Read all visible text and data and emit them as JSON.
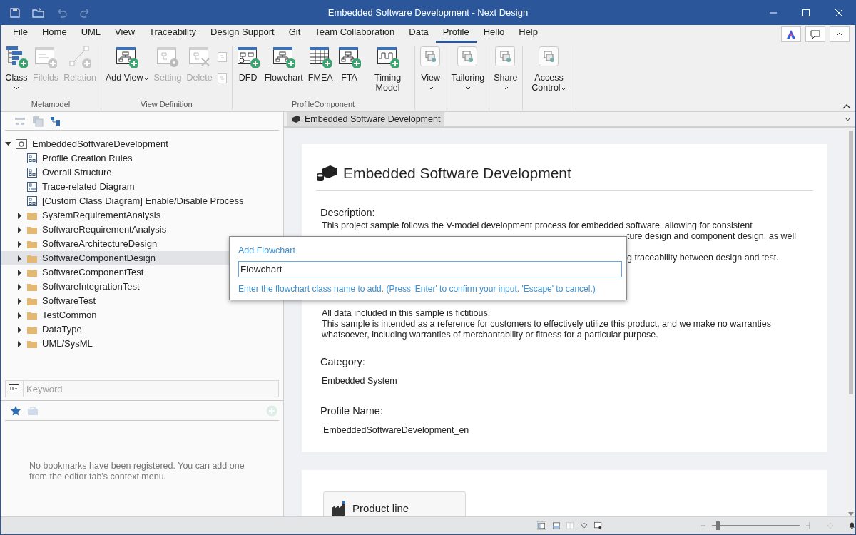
{
  "window": {
    "title": "Embedded Software Development - Next Design"
  },
  "menu": [
    {
      "label": "File",
      "selected": false
    },
    {
      "label": "Home",
      "selected": false
    },
    {
      "label": "UML",
      "selected": false
    },
    {
      "label": "View",
      "selected": false
    },
    {
      "label": "Traceability",
      "selected": false
    },
    {
      "label": "Design Support",
      "selected": false
    },
    {
      "label": "Git",
      "selected": false
    },
    {
      "label": "Team Collaboration",
      "selected": false
    },
    {
      "label": "Data",
      "selected": false
    },
    {
      "label": "Profile",
      "selected": true
    },
    {
      "label": "Hello",
      "selected": false
    },
    {
      "label": "Help",
      "selected": false
    }
  ],
  "ribbon_groups": [
    {
      "label": "Metamodel",
      "buttons": [
        {
          "label": "Class",
          "kind": "class",
          "disabled": false,
          "dropdown": true
        },
        {
          "label": "Filelds",
          "kind": "fields",
          "disabled": true,
          "dropdown": false
        },
        {
          "label": "Relation",
          "kind": "relation",
          "disabled": true,
          "dropdown": false
        }
      ]
    },
    {
      "label": "View Definition",
      "buttons": [
        {
          "label": "Add View",
          "kind": "diagram",
          "disabled": false,
          "dropdown": true
        },
        {
          "label": "Setting",
          "kind": "setting",
          "disabled": true,
          "dropdown": false
        },
        {
          "label": "Delete",
          "kind": "delete",
          "disabled": true,
          "dropdown": false
        },
        {
          "kind": "small-pair",
          "disabled": true
        }
      ]
    },
    {
      "label": "ProfileComponent",
      "buttons": [
        {
          "label": "DFD",
          "kind": "dfd",
          "disabled": false,
          "dropdown": false
        },
        {
          "label": "Flowchart",
          "kind": "diagram",
          "disabled": false,
          "dropdown": false
        },
        {
          "label": "FMEA",
          "kind": "table",
          "disabled": false,
          "dropdown": false
        },
        {
          "label": "FTA",
          "kind": "diagram",
          "disabled": false,
          "dropdown": false
        },
        {
          "label": "Timing Model",
          "kind": "timing",
          "disabled": false,
          "dropdown": false
        }
      ]
    },
    {
      "buttons": [
        {
          "label": "View",
          "kind": "tile",
          "disabled": false,
          "dropdown": true
        }
      ]
    },
    {
      "buttons": [
        {
          "label": "Tailoring",
          "kind": "tile",
          "disabled": false,
          "dropdown": true
        }
      ]
    },
    {
      "buttons": [
        {
          "label": "Share",
          "kind": "tile",
          "disabled": false,
          "dropdown": true
        }
      ]
    },
    {
      "buttons": [
        {
          "label": "Access Control",
          "kind": "tile",
          "disabled": false,
          "dropdown": true
        }
      ]
    }
  ],
  "tree": [
    {
      "label": "EmbeddedSoftwareDevelopment",
      "kind": "project",
      "expanded": true,
      "selected": false,
      "children": [
        {
          "label": "Profile Creation Rules",
          "kind": "diagram",
          "selected": false
        },
        {
          "label": "Overall Structure",
          "kind": "diagram",
          "selected": false
        },
        {
          "label": "Trace-related Diagram",
          "kind": "diagram",
          "selected": false
        },
        {
          "label": "[Custom Class Diagram] Enable/Disable Process",
          "kind": "diagram",
          "selected": false
        },
        {
          "label": "SystemRequirementAnalysis",
          "kind": "folder",
          "expanded": false,
          "selected": false
        },
        {
          "label": "SoftwareRequirementAnalysis",
          "kind": "folder",
          "expanded": false,
          "selected": false
        },
        {
          "label": "SoftwareArchitectureDesign",
          "kind": "folder",
          "expanded": false,
          "selected": false
        },
        {
          "label": "SoftwareComponentDesign",
          "kind": "folder",
          "expanded": false,
          "selected": true
        },
        {
          "label": "SoftwareComponentTest",
          "kind": "folder",
          "expanded": false,
          "selected": false
        },
        {
          "label": "SoftwareIntegrationTest",
          "kind": "folder",
          "expanded": false,
          "selected": false
        },
        {
          "label": "SoftwareTest",
          "kind": "folder",
          "expanded": false,
          "selected": false
        },
        {
          "label": "TestCommon",
          "kind": "folder",
          "expanded": false,
          "selected": false
        },
        {
          "label": "DataType",
          "kind": "folder",
          "expanded": false,
          "selected": false
        },
        {
          "label": "UML/SysML",
          "kind": "folder",
          "expanded": false,
          "selected": false
        }
      ]
    }
  ],
  "search": {
    "placeholder": "Keyword"
  },
  "bookmarks": {
    "message": "No bookmarks have been registered. You can add one from the editor tab's context menu."
  },
  "editor_tab": {
    "label": "Embedded Software Development"
  },
  "overview": {
    "title": "Embedded Software Development",
    "description_label": "Description:",
    "description_lines": [
      "This project sample follows the V-model development process for embedded software, allowing for consistent",
      "ture design and component design, as well",
      "g traceability between design and test."
    ],
    "notes": [
      "All data included in this sample is fictitious.",
      "This sample is intended as a reference for customers to effectively utilize this product, and we make no warranties whatsoever, including warranties of merchantability or fitness for a particular purpose."
    ],
    "category_label": "Category:",
    "category": "Embedded System",
    "profile_name_label": "Profile Name:",
    "profile_name": "EmbeddedSoftwareDevelopment_en"
  },
  "product_line": {
    "label": "Product line"
  },
  "dialog": {
    "title": "Add Flowchart",
    "value": "Flowchart",
    "hint": "Enter the flowchart class name to add. (Press 'Enter' to confirm your input. 'Escape' to cancel.)"
  },
  "zoom": {
    "level": 0.04
  }
}
